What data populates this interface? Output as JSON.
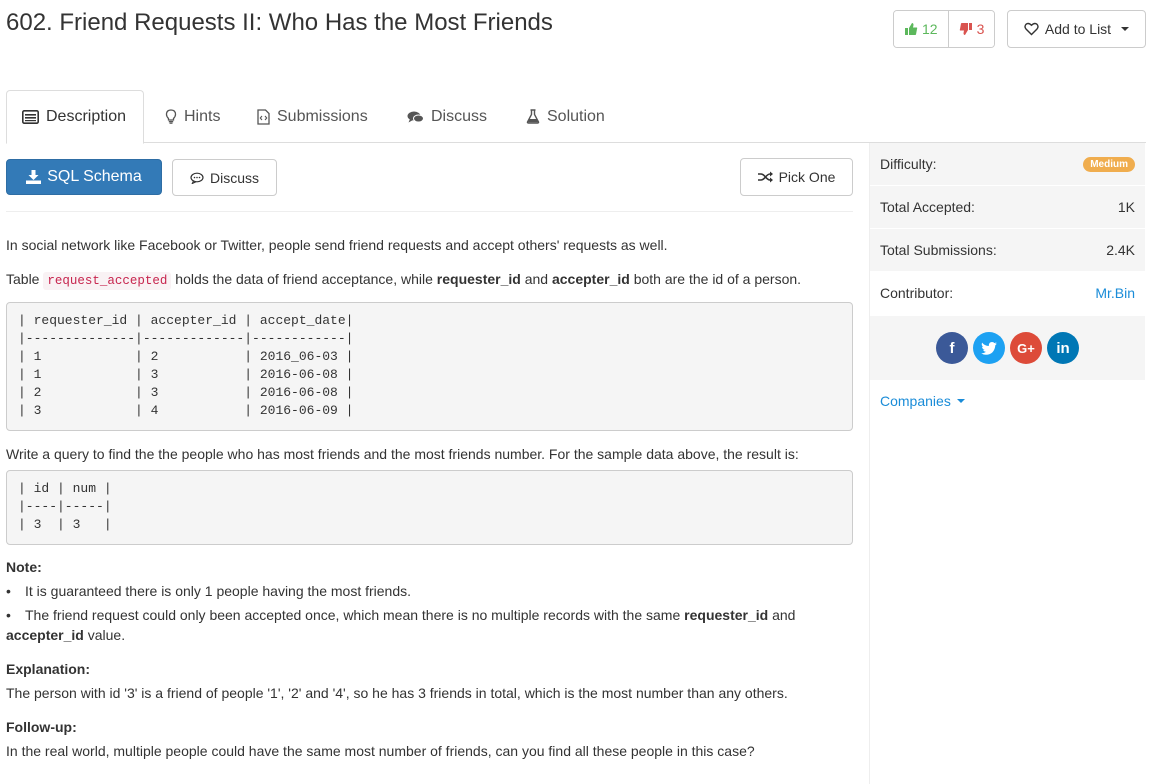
{
  "header": {
    "title": "602. Friend Requests II: Who Has the Most Friends",
    "upvotes": "12",
    "downvotes": "3",
    "add_to_list": "Add to List"
  },
  "tabs": [
    {
      "label": "Description",
      "icon": "list-icon",
      "active": true
    },
    {
      "label": "Hints",
      "icon": "lightbulb-icon"
    },
    {
      "label": "Submissions",
      "icon": "code-file-icon"
    },
    {
      "label": "Discuss",
      "icon": "comments-icon"
    },
    {
      "label": "Solution",
      "icon": "flask-icon"
    }
  ],
  "toolbar": {
    "schema_label": "SQL Schema",
    "discuss_label": "Discuss",
    "pick_label": "Pick One"
  },
  "content": {
    "intro": "In social network like Facebook or Twitter, people send friend requests and accept others' requests as well.",
    "table_sentence": {
      "prefix": "Table",
      "table_name": "request_accepted",
      "middle": "holds the data of friend acceptance, while",
      "field1": "requester_id",
      "and": "and",
      "field2": "accepter_id",
      "suffix": "both are the id of a person."
    },
    "sample_table": "| requester_id | accepter_id | accept_date|\n|--------------|-------------|------------|\n| 1            | 2           | 2016_06-03 |\n| 1            | 3           | 2016-06-08 |\n| 2            | 3           | 2016-06-08 |\n| 3            | 4           | 2016-06-09 |",
    "query_sentence": "Write a query to find the the people who has most friends and the most friends number. For the sample data above, the result is:",
    "result_table": "| id | num |\n|----|-----|\n| 3  | 3   |",
    "note_heading": "Note:",
    "note1": "It is guaranteed there is only 1 people having the most friends.",
    "note2_prefix": "The friend request could only been accepted once, which mean there is no multiple records with the same",
    "note2_field1": "requester_id",
    "note2_and": "and",
    "note2_field2": "accepter_id",
    "note2_suffix": "value.",
    "explanation_heading": "Explanation:",
    "explanation": "The person with id '3' is a friend of people '1', '2' and '4', so he has 3 friends in total, which is the most number than any others.",
    "followup_heading": "Follow-up:",
    "followup": "In the real world, multiple people could have the same most number of friends, can you find all these people in this case?"
  },
  "sidebar": {
    "difficulty_label": "Difficulty:",
    "difficulty_value": "Medium",
    "accepted_label": "Total Accepted:",
    "accepted_value": "1K",
    "submissions_label": "Total Submissions:",
    "submissions_value": "2.4K",
    "contributor_label": "Contributor:",
    "contributor_value": "Mr.Bin",
    "companies_label": "Companies",
    "social_fb": "f",
    "social_gp": "G+",
    "social_li": "in"
  },
  "colors": {
    "primary": "#337ab7",
    "upvote": "#5cb85c",
    "downvote": "#d9534f",
    "medium_badge": "#f0ad4e",
    "link": "#1a8cd8"
  }
}
